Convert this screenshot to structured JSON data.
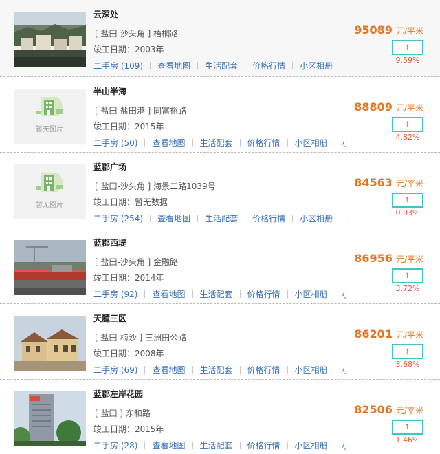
{
  "labels": {
    "link_secondhand": "二手房",
    "link_map": "查看地图",
    "link_life": "生活配套",
    "link_price": "价格行情",
    "link_album": "小区相册",
    "link_more": "小区",
    "built_prefix": "竣工日期：",
    "price_unit": "元/平米",
    "no_image": "暂无图片",
    "up_arrow": "↑"
  },
  "colors": {
    "price": "#e6741f",
    "link": "#3a6fb7",
    "highlight_border": "#3bc6c9",
    "change_text": "#e65a3a"
  },
  "listings": [
    {
      "name": "云深处",
      "district": "[ 盐田-沙头角 ]",
      "road": "梧桐路",
      "built": "2003年",
      "secondhand_count": "(109)",
      "price": "95089",
      "change": "9.59%",
      "image": "photo-hillside"
    },
    {
      "name": "半山半海",
      "district": "[ 盐田-盐田港 ]",
      "road": "同富裕路",
      "built": "2015年",
      "secondhand_count": "(50)",
      "price": "88809",
      "change": "4.82%",
      "image": "placeholder"
    },
    {
      "name": "蓝郡广场",
      "district": "[ 盐田-沙头角 ]",
      "road": "海景二路1039号",
      "built": "暂无数据",
      "secondhand_count": "(254)",
      "price": "84563",
      "change": "0.03%",
      "image": "placeholder"
    },
    {
      "name": "蓝郡西堤",
      "district": "[ 盐田-沙头角 ]",
      "road": "金融路",
      "built": "2014年",
      "secondhand_count": "(92)",
      "price": "86956",
      "change": "3.72%",
      "image": "photo-construction"
    },
    {
      "name": "天麓三区",
      "district": "[ 盐田-梅沙 ]",
      "road": "三洲田公路",
      "built": "2008年",
      "secondhand_count": "(69)",
      "price": "86201",
      "change": "3.68%",
      "image": "photo-villa"
    },
    {
      "name": "蓝郡左岸花园",
      "district": "[ 盐田 ]",
      "road": "东和路",
      "built": "2015年",
      "secondhand_count": "(28)",
      "price": "82506",
      "change": "1.46%",
      "image": "photo-tower"
    }
  ]
}
